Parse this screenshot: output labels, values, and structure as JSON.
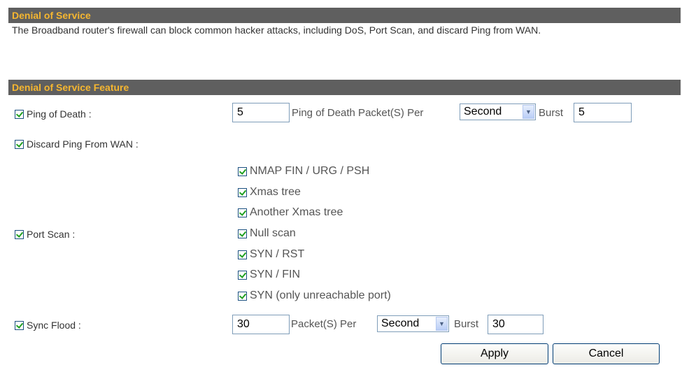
{
  "header": {
    "title": "Denial of Service"
  },
  "description": "The Broadband router's firewall can block common hacker attacks, including DoS, Port Scan, and discard Ping from WAN.",
  "feature_header": {
    "title": "Denial of Service Feature"
  },
  "ping_of_death": {
    "label": "Ping of Death :",
    "checked": true,
    "value": "5",
    "packet_label": "Ping of Death Packet(S) Per",
    "unit": "Second",
    "burst_label": "Burst",
    "burst_value": "5"
  },
  "discard_ping": {
    "label": "Discard Ping From WAN :",
    "checked": true
  },
  "port_scan": {
    "label": "Port Scan :",
    "checked": true,
    "options": [
      {
        "label": "NMAP FIN / URG / PSH",
        "checked": true
      },
      {
        "label": "Xmas tree",
        "checked": true
      },
      {
        "label": "Another Xmas tree",
        "checked": true
      },
      {
        "label": "Null scan",
        "checked": true
      },
      {
        "label": "SYN / RST",
        "checked": true
      },
      {
        "label": "SYN / FIN",
        "checked": true
      },
      {
        "label": "SYN (only unreachable port)",
        "checked": true
      }
    ]
  },
  "sync_flood": {
    "label": "Sync Flood :",
    "checked": true,
    "value": "30",
    "packet_label": "Packet(S) Per",
    "unit": "Second",
    "burst_label": "Burst",
    "burst_value": "30"
  },
  "buttons": {
    "apply": "Apply",
    "cancel": "Cancel"
  },
  "colors": {
    "header_bg": "#5f5f5f",
    "header_text": "#f5b630",
    "check": "#21a121"
  }
}
